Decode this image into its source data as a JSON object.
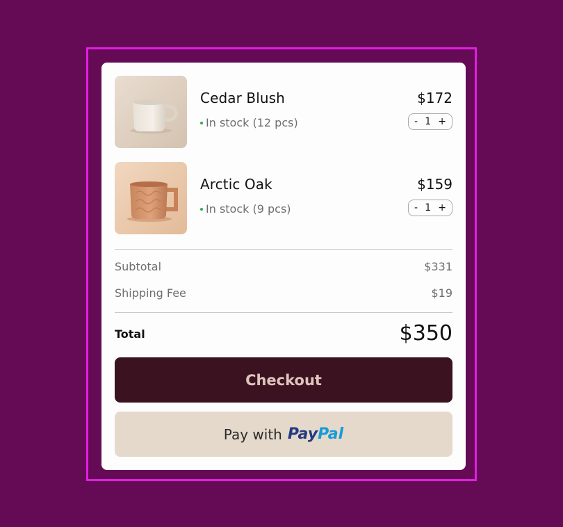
{
  "cart": {
    "items": [
      {
        "name": "Cedar Blush",
        "price": "$172",
        "stock": "In stock (12 pcs)",
        "quantity": "1",
        "image": "cream-mug-image"
      },
      {
        "name": "Arctic Oak",
        "price": "$159",
        "stock": "In stock (9 pcs)",
        "quantity": "1",
        "image": "terracotta-mug-image"
      }
    ],
    "stepper": {
      "minus": "-",
      "plus": "+"
    }
  },
  "summary": {
    "subtotal_label": "Subtotal",
    "subtotal_value": "$331",
    "shipping_label": "Shipping Fee",
    "shipping_value": "$19",
    "total_label": "Total",
    "total_value": "$350"
  },
  "actions": {
    "checkout_label": "Checkout",
    "paypal_prefix": "Pay with",
    "paypal_brand_1": "Pay",
    "paypal_brand_2": "Pal"
  },
  "colors": {
    "background": "#650a55",
    "frame_border": "#e21de4",
    "checkout_bg": "#3b1320",
    "checkout_text": "#e0c5be",
    "paypal_bg": "#e5d9cb",
    "stock_dot": "#2faa4b",
    "paypal_dark": "#253b80",
    "paypal_light": "#179bd7"
  }
}
